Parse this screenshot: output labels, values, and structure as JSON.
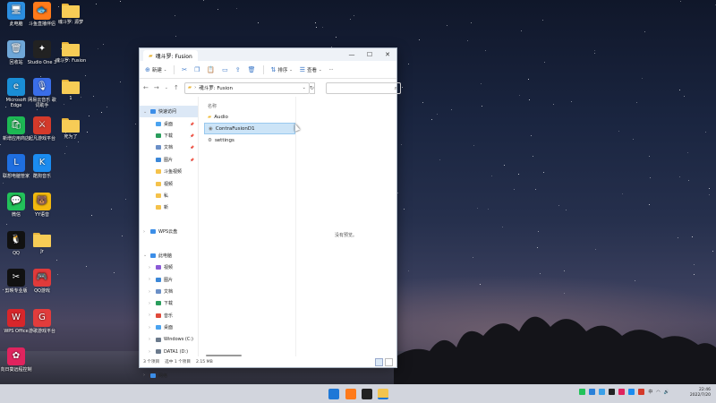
{
  "desktop": {
    "icons": [
      {
        "label": "此电脑",
        "color": "#2c8ee0",
        "glyph": "🖥"
      },
      {
        "label": "斗鱼直播伴侣",
        "color": "#ff7a1a",
        "glyph": "🐟"
      },
      {
        "label": "魂斗罗: 源梦",
        "color": "folder",
        "glyph": ""
      },
      {
        "label": "回收站",
        "color": "#6fa7d8",
        "glyph": "🗑"
      },
      {
        "label": "Studio One 3",
        "color": "#222222",
        "glyph": "✦"
      },
      {
        "label": "魂斗罗: Fusion",
        "color": "folder",
        "glyph": ""
      },
      {
        "label": "Microsoft Edge",
        "color": "#1a8ed6",
        "glyph": "e"
      },
      {
        "label": "网易云音乐 歌词助手",
        "color": "#3a6ee8",
        "glyph": "🎙"
      },
      {
        "label": "1",
        "color": "folder",
        "glyph": ""
      },
      {
        "label": "新增应用商店",
        "color": "#1db954",
        "glyph": "🛍"
      },
      {
        "label": "起凡游戏平台",
        "color": "#d43a2a",
        "glyph": "⚔"
      },
      {
        "label": "死为了",
        "color": "folder",
        "glyph": ""
      },
      {
        "label": "联想电脑管家",
        "color": "#1f6fe0",
        "glyph": "L"
      },
      {
        "label": "酷狗音乐",
        "color": "#1b8cf0",
        "glyph": "K"
      },
      {
        "label": "微信",
        "color": "#22c25a",
        "glyph": "💬"
      },
      {
        "label": "YY语音",
        "color": "#f2b80f",
        "glyph": "🐻"
      },
      {
        "label": "QQ",
        "color": "#111111",
        "glyph": "🐧"
      },
      {
        "label": "Jr",
        "color": "folder",
        "glyph": ""
      },
      {
        "label": "剪映专业版",
        "color": "#111111",
        "glyph": "✂"
      },
      {
        "label": "QQ游戏",
        "color": "#e03a3a",
        "glyph": "🎮"
      },
      {
        "label": "WPS Office",
        "color": "#d8262b",
        "glyph": "W"
      },
      {
        "label": "游歌游戏平台",
        "color": "#e23c3c",
        "glyph": "G"
      },
      {
        "label": "向日葵远程控制",
        "color": "#e0245e",
        "glyph": "✿"
      }
    ]
  },
  "window": {
    "tab_title": "魂斗罗: Fusion",
    "controls": {
      "minimize": "—",
      "maximize": "☐",
      "close": "✕"
    },
    "toolbar": {
      "new_label": "新建",
      "sort_label": "排序",
      "view_label": "查看",
      "more_label": "···"
    },
    "navbar": {
      "back": "←",
      "forward": "→",
      "recent": "⌄",
      "up": "↑",
      "path": "魂斗罗: Fusion",
      "refresh": "↻",
      "search_placeholder": ""
    },
    "sidebar": [
      {
        "label": "快速访问",
        "level": 0,
        "color": "#3c8ee8",
        "chev": "⌄",
        "pin": "",
        "sel": true
      },
      {
        "label": "桌面",
        "level": 1,
        "color": "#4aa3f0",
        "chev": "",
        "pin": "📌",
        "sel": false
      },
      {
        "label": "下载",
        "level": 1,
        "color": "#2a9d5c",
        "chev": "",
        "pin": "📌",
        "sel": false
      },
      {
        "label": "文档",
        "level": 1,
        "color": "#6b8fc7",
        "chev": "",
        "pin": "📌",
        "sel": false
      },
      {
        "label": "图片",
        "level": 1,
        "color": "#3b87d8",
        "chev": "",
        "pin": "📌",
        "sel": false
      },
      {
        "label": "斗鱼视频",
        "level": 1,
        "color": "#f5c24a",
        "chev": "",
        "pin": "",
        "sel": false
      },
      {
        "label": "视频",
        "level": 1,
        "color": "#f5c24a",
        "chev": "",
        "pin": "",
        "sel": false
      },
      {
        "label": "私",
        "level": 1,
        "color": "#f5c24a",
        "chev": "",
        "pin": "",
        "sel": false
      },
      {
        "label": "新",
        "level": 1,
        "color": "#f5c24a",
        "chev": "",
        "pin": "",
        "sel": false
      },
      {
        "label": "",
        "level": 0,
        "color": "",
        "chev": "",
        "pin": "",
        "sel": false
      },
      {
        "label": "WPS云盘",
        "level": 0,
        "color": "#3c8ee8",
        "chev": "›",
        "pin": "",
        "sel": false
      },
      {
        "label": "",
        "level": 0,
        "color": "",
        "chev": "",
        "pin": "",
        "sel": false
      },
      {
        "label": "此电脑",
        "level": 0,
        "color": "#3c8ee8",
        "chev": "⌄",
        "pin": "",
        "sel": false
      },
      {
        "label": "视频",
        "level": 1,
        "color": "#8b5ad6",
        "chev": "›",
        "pin": "",
        "sel": false
      },
      {
        "label": "图片",
        "level": 1,
        "color": "#3b87d8",
        "chev": "›",
        "pin": "",
        "sel": false
      },
      {
        "label": "文档",
        "level": 1,
        "color": "#6b8fc7",
        "chev": "›",
        "pin": "",
        "sel": false
      },
      {
        "label": "下载",
        "level": 1,
        "color": "#2a9d5c",
        "chev": "›",
        "pin": "",
        "sel": false
      },
      {
        "label": "音乐",
        "level": 1,
        "color": "#e04a3a",
        "chev": "›",
        "pin": "",
        "sel": false
      },
      {
        "label": "桌面",
        "level": 1,
        "color": "#4aa3f0",
        "chev": "›",
        "pin": "",
        "sel": false
      },
      {
        "label": "Windows (C:)",
        "level": 1,
        "color": "#6b7a8c",
        "chev": "›",
        "pin": "",
        "sel": false
      },
      {
        "label": "DATA1 (D:)",
        "level": 1,
        "color": "#6b7a8c",
        "chev": "›",
        "pin": "",
        "sel": false
      },
      {
        "label": "",
        "level": 0,
        "color": "",
        "chev": "",
        "pin": "",
        "sel": false
      },
      {
        "label": "网络",
        "level": 0,
        "color": "#3c8ee8",
        "chev": "›",
        "pin": "",
        "sel": false
      }
    ],
    "column_name": "名称",
    "files": [
      {
        "name": "Audio",
        "type": "folder",
        "sel": false
      },
      {
        "name": "ContraFusionD1",
        "type": "app",
        "sel": true
      },
      {
        "name": "settings",
        "type": "settings",
        "sel": false
      }
    ],
    "preview_text": "没有预览。",
    "status": {
      "count": "3 个项目",
      "selected": "选中 1 个项目",
      "size": "2.15 MB"
    }
  },
  "taskbar": {
    "clock_time": "22:46",
    "clock_date": "2022/7/20",
    "ime": "中"
  }
}
